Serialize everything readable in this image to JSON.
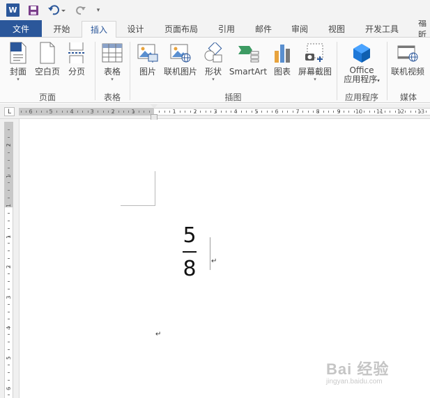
{
  "quick_access": {
    "app_logo": "W",
    "icons": [
      "word-logo-icon",
      "save-icon",
      "undo-icon",
      "redo-icon",
      "customize-icon"
    ],
    "customize_glyph": "▾"
  },
  "tabs": [
    {
      "label": "文件"
    },
    {
      "label": "开始"
    },
    {
      "label": "插入"
    },
    {
      "label": "设计"
    },
    {
      "label": "页面布局"
    },
    {
      "label": "引用"
    },
    {
      "label": "邮件"
    },
    {
      "label": "审阅"
    },
    {
      "label": "视图"
    },
    {
      "label": "开发工具"
    },
    {
      "label": "福昕"
    }
  ],
  "active_tab": "插入",
  "ribbon": {
    "pages": {
      "cover": "封面",
      "blank_page": "空白页",
      "page_break": "分页",
      "group": "页面"
    },
    "tables": {
      "table": "表格",
      "group": "表格"
    },
    "illustrations": {
      "picture": "图片",
      "online_picture": "联机图片",
      "shapes": "形状",
      "smartart": "SmartArt",
      "chart": "图表",
      "screenshot": "屏幕截图",
      "group": "插图"
    },
    "apps": {
      "office_line1": "Office",
      "office_line2": "应用程序",
      "group": "应用程序"
    },
    "media": {
      "online_video": "联机视频",
      "group": "媒体"
    },
    "dropdown_glyph": "▾"
  },
  "ruler": {
    "corner": "L",
    "h_numbers": [
      "6",
      "5",
      "4",
      "3",
      "2",
      "1",
      "1",
      "2",
      "3",
      "4",
      "5",
      "6",
      "7",
      "8",
      "9",
      "10",
      "11",
      "12",
      "13"
    ],
    "v_numbers": [
      "2",
      "1",
      "1",
      "1",
      "2",
      "3",
      "4",
      "5",
      "6"
    ]
  },
  "document": {
    "numerator": "5",
    "denominator": "8",
    "paragraph_mark": "↵"
  },
  "watermark": {
    "text": "Bai 经验",
    "url": "jingyan.baidu.com"
  },
  "colors": {
    "word_blue": "#2b579a",
    "tab_background": "#f3f3f3",
    "ribbon_background": "#fafafa"
  }
}
